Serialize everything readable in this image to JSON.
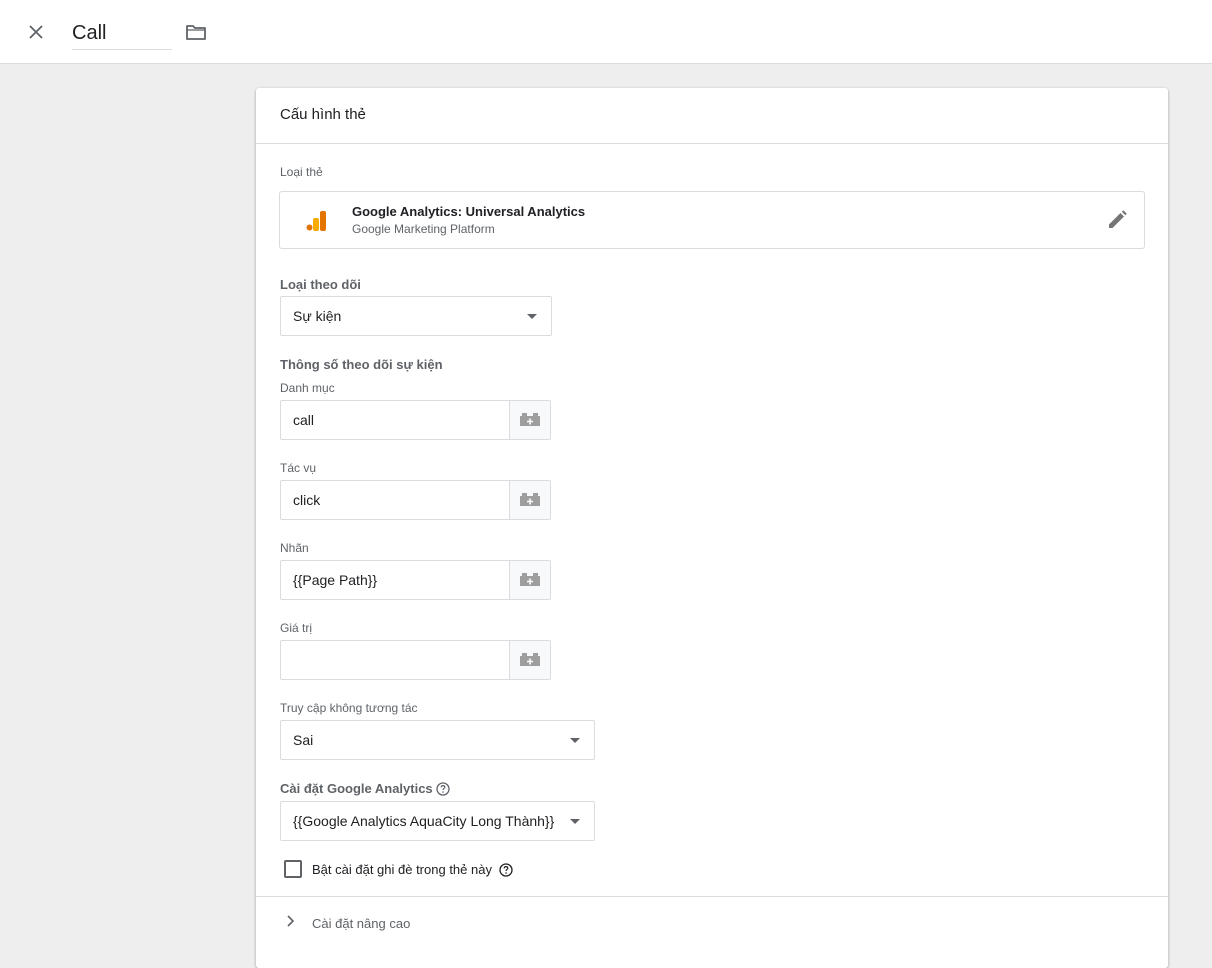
{
  "header": {
    "tag_name": "Call"
  },
  "card": {
    "title": "Cấu hình thẻ",
    "tag_type": {
      "label": "Loại thẻ",
      "name": "Google Analytics: Universal Analytics",
      "provider": "Google Marketing Platform",
      "icon": "google-analytics-icon",
      "icon_color": "#e37400"
    },
    "track_type": {
      "label": "Loại theo dõi",
      "value": "Sự kiện"
    },
    "event_params": {
      "label": "Thông số theo dõi sự kiện",
      "category": {
        "label": "Danh mục",
        "value": "call"
      },
      "action": {
        "label": "Tác vụ",
        "value": "click"
      },
      "event_label": {
        "label": "Nhãn",
        "value": "{{Page Path}}"
      },
      "event_value": {
        "label": "Giá trị",
        "value": ""
      }
    },
    "non_interaction": {
      "label": "Truy cập không tương tác",
      "value": "Sai"
    },
    "ga_settings": {
      "label": "Cài đặt Google Analytics",
      "value": "{{Google Analytics AquaCity Long Thành}}"
    },
    "override": {
      "label": "Bật cài đặt ghi đè trong thẻ này",
      "checked": false
    },
    "advanced": {
      "label": "Cài đặt nâng cao"
    }
  }
}
